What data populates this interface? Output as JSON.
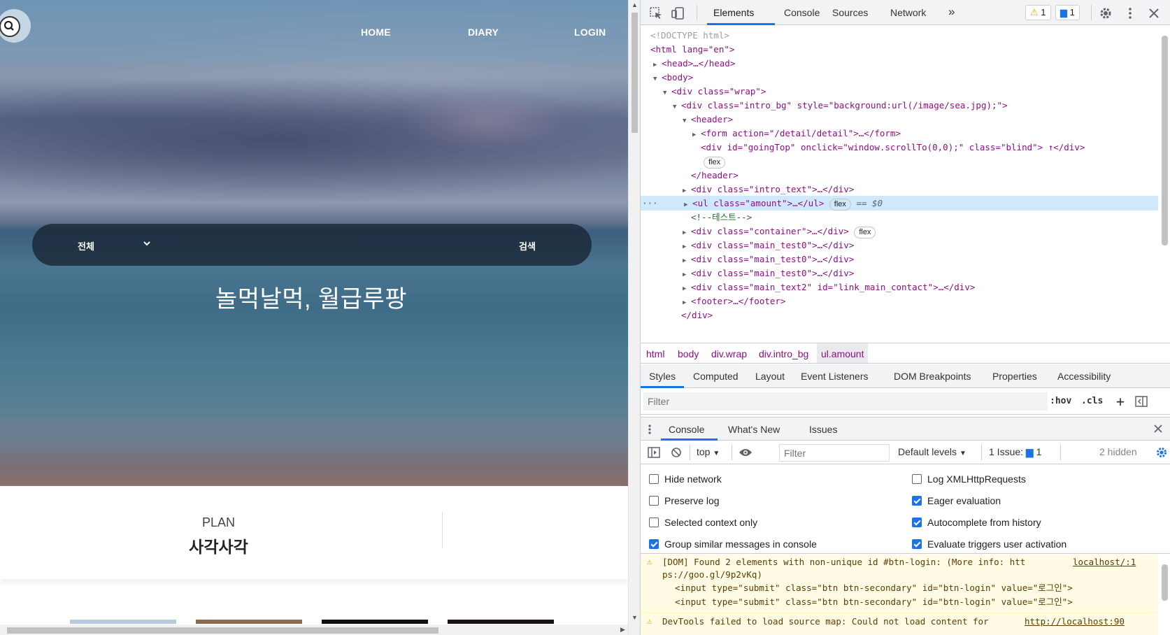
{
  "page": {
    "nav": {
      "home": "HOME",
      "diary": "DIARY",
      "login": "LOGIN"
    },
    "search": {
      "category": "전체",
      "button": "검색"
    },
    "hero_title": "놀먹날먹, 월급루팡",
    "amount": {
      "label": "PLAN",
      "title": "사각사각"
    },
    "thumb_colors": [
      "#b8cce0",
      "#8a6a4a",
      "#111111",
      "#1a1210"
    ]
  },
  "devtools": {
    "tabs": [
      "Elements",
      "Console",
      "Sources",
      "Network",
      "»"
    ],
    "warning_count": "1",
    "message_count": "1",
    "dom": {
      "doctype": "<!DOCTYPE html>",
      "html_open": "<html lang=\"en\">",
      "head": "<head>…</head>",
      "body_open": "<body>",
      "wrap_open": "<div class=\"wrap\">",
      "intro_bg_tag": "<div class=\"intro_bg\" style=\"background:url(/image/sea.jpg);\">",
      "header_open": "<header>",
      "form": "<form action=\"/detail/detail\">…</form>",
      "goingtop": "<div id=\"goingTop\" onclick=\"window.scrollTo(0,0);\" class=\"blind\"> ↑</div>",
      "flex_pill": "flex",
      "header_close": "</header>",
      "intro_text": "<div class=\"intro_text\">…</div>",
      "amount": "<ul class=\"amount\">…</ul>",
      "eq_label": "== $0",
      "comment": "<!--테스트-->",
      "container": "<div class=\"container\">…</div>",
      "main_test0": "<div class=\"main_test0\">…</div>",
      "main_text2": "<div class=\"main_text2\" id=\"link_main_contact\">…</div>",
      "footer": "<footer>…</footer>",
      "div_close": "</div>"
    },
    "breadcrumbs": [
      "html",
      "body",
      "div.wrap",
      "div.intro_bg",
      "ul.amount"
    ],
    "style_tabs": [
      "Styles",
      "Computed",
      "Layout",
      "Event Listeners",
      "DOM Breakpoints",
      "Properties",
      "Accessibility"
    ],
    "styles_filter_placeholder": "Filter",
    "hov": ":hov",
    "cls": ".cls",
    "drawer_tabs": [
      "Console",
      "What's New",
      "Issues"
    ],
    "console_toolbar": {
      "context": "top",
      "filter_placeholder": "Filter",
      "levels": "Default levels",
      "issues_label": "1 Issue:",
      "issues_count": "1",
      "hidden": "2 hidden"
    },
    "settings": [
      {
        "label": "Hide network",
        "checked": false
      },
      {
        "label": "Log XMLHttpRequests",
        "checked": false
      },
      {
        "label": "Preserve log",
        "checked": false
      },
      {
        "label": "Eager evaluation",
        "checked": true
      },
      {
        "label": "Selected context only",
        "checked": false
      },
      {
        "label": "Autocomplete from history",
        "checked": true
      },
      {
        "label": "Group similar messages in console",
        "checked": true
      },
      {
        "label": "Evaluate triggers user activation",
        "checked": true
      }
    ],
    "messages": {
      "warn1_line1": "[DOM] Found 2 elements with non-unique id #btn-login: (More info: htt",
      "warn1_source": "localhost/:1",
      "warn1_line2": "ps://goo.gl/9p2vKq)",
      "warn1_line3": "<input type=\"submit\" class=\"btn btn-secondary\" id=\"btn-login\" value=\"로그인\">",
      "warn1_line4": "<input type=\"submit\" class=\"btn btn-secondary\" id=\"btn-login\" value=\"로그인\">",
      "warn2_line1": "DevTools failed to load source map: Could not load content for ",
      "warn2_link": "http://localhost:90"
    },
    "colors": {
      "accent": "#1a73e8",
      "selected_row": "#cfe8fc",
      "tag": "#881280",
      "attr": "#994500",
      "value": "#1a1aa6",
      "comment": "#236e25",
      "warning_bg": "#fffbe5"
    }
  }
}
